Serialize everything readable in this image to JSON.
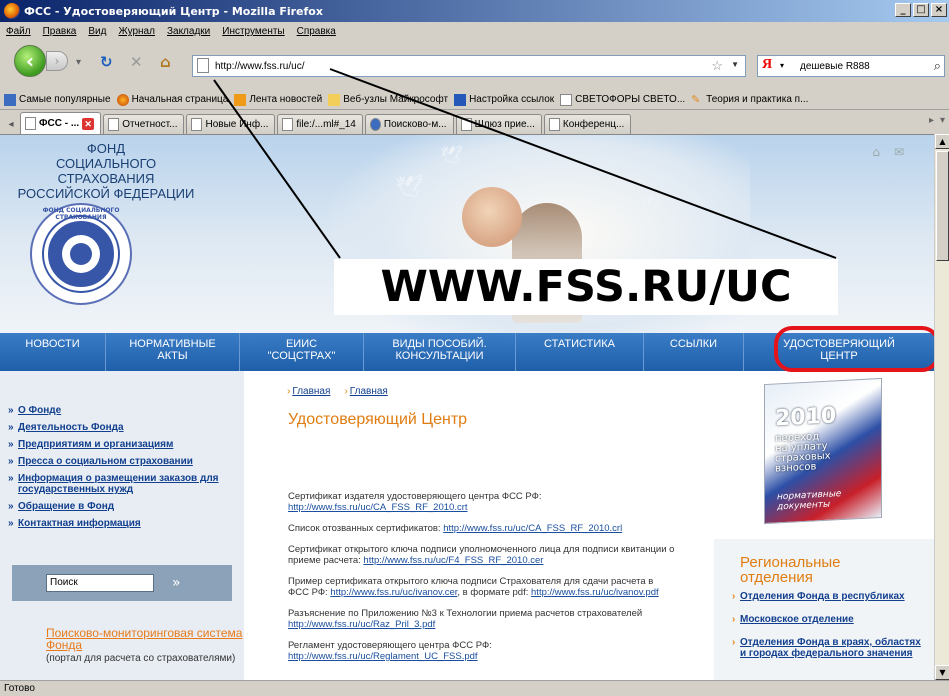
{
  "window": {
    "title": "ФСС - Удостоверяющий Центр - Mozilla Firefox",
    "minimize": "_",
    "maximize": "□",
    "close": "×"
  },
  "menu": [
    "Файл",
    "Правка",
    "Вид",
    "Журнал",
    "Закладки",
    "Инструменты",
    "Справка"
  ],
  "nav": {
    "url": "http://www.fss.ru/uc/",
    "search_value": "дешевые R888",
    "search_engine": "Я"
  },
  "bookmarks": [
    {
      "label": "Самые популярные",
      "icon": "blue-square-icon"
    },
    {
      "label": "Начальная страница",
      "icon": "firefox-icon"
    },
    {
      "label": "Лента новостей",
      "icon": "rss-icon"
    },
    {
      "label": "Веб-узлы Майкрософт",
      "icon": "folder-icon"
    },
    {
      "label": "Настройка ссылок",
      "icon": "ms-icon"
    },
    {
      "label": "СВЕТОФОРЫ СВЕТО...",
      "icon": "page-icon"
    },
    {
      "label": "Теория и практика п...",
      "icon": "pencil-icon"
    }
  ],
  "tabs": [
    {
      "label": "ФСС - ...",
      "active": true
    },
    {
      "label": "Отчетност...",
      "active": false
    },
    {
      "label": "Новые Инф...",
      "active": false
    },
    {
      "label": "file:/...ml#_14",
      "active": false
    },
    {
      "label": "Поисково-м...",
      "active": false
    },
    {
      "label": "Шлюз прие...",
      "active": false
    },
    {
      "label": "Конференц...",
      "active": false
    }
  ],
  "page": {
    "org_name": "ФОНД\nСОЦИАЛЬНОГО СТРАХОВАНИЯ\nРОССИЙСКОЙ ФЕДЕРАЦИИ",
    "emblem_text": "ФОНД СОЦИАЛЬНОГО СТРАХОВАНИЯ",
    "overlay_url": "WWW.FSS.RU/UC",
    "main_nav": [
      {
        "label": "НОВОСТИ"
      },
      {
        "label": "НОРМАТИВНЫЕ\nАКТЫ"
      },
      {
        "label": "ЕИИС\n\"СОЦСТРАХ\""
      },
      {
        "label": "ВИДЫ ПОСОБИЙ.\nКОНСУЛЬТАЦИИ"
      },
      {
        "label": "СТАТИСТИКА"
      },
      {
        "label": "ССЫЛКИ"
      },
      {
        "label": "УДОСТОВЕРЯЮЩИЙ\nЦЕНТР"
      }
    ],
    "left_menu": [
      "О Фонде",
      "Деятельность Фонда",
      "Предприятиям и организациям",
      "Пресса о социальном страховании",
      "Информация о размещении заказов для государственных нужд",
      "Обращение в Фонд",
      "Контактная информация"
    ],
    "search_placeholder": "Поиск",
    "promo_title": "Поисково-мониторинговая система Фонда",
    "promo_desc": "(портал для расчета со страхователями)",
    "breadcrumb": [
      "Главная",
      "Главная"
    ],
    "page_title": "Удостоверяющий Центр",
    "paragraphs": [
      {
        "text": "Сертификат издателя удостоверяющего центра ФСС РФ: ",
        "link": "http://www.fss.ru/uc/CA_FSS_RF_2010.crt",
        "text2": "",
        "link2": ""
      },
      {
        "text": "Список отозванных сертификатов:  ",
        "link": "http://www.fss.ru/uc/CA_FSS_RF_2010.crl",
        "text2": "",
        "link2": ""
      },
      {
        "text": "Сертификат открытого ключа подписи уполномоченного лица для подписи квитанции о приеме расчета: ",
        "link": "http://www.fss.ru/uc/F4_FSS_RF_2010.cer",
        "text2": "",
        "link2": ""
      },
      {
        "text": "Пример сертификата открытого ключа подписи Страхователя для сдачи расчета в ФСС РФ: ",
        "link": "http://www.fss.ru/uc/ivanov.cer",
        "text2": ", в формате pdf: ",
        "link2": "http://www.fss.ru/uc/ivanov.pdf"
      },
      {
        "text": "Разъяснение по Приложению №3 к Технологии приема расчетов страхователей ",
        "link": "http://www.fss.ru/uc/Raz_Pril_3.pdf",
        "text2": "",
        "link2": ""
      },
      {
        "text": "Регламент удостоверяющего центра ФСС РФ: ",
        "link": "http://www.fss.ru/uc/Reglament_UC_FSS.pdf",
        "text2": "",
        "link2": ""
      }
    ],
    "book": {
      "year": "2010",
      "title": "переход\nна уплату\nстраховых\nвзносов",
      "subtitle": "нормативные\nдокументы"
    },
    "regional_title": "Региональные\nотделения",
    "regional_items": [
      "Отделения Фонда в республиках",
      "Московское отделение",
      "Отделения Фонда в краях, областях и городах федерального значения"
    ]
  },
  "status": "Готово",
  "colors": {
    "accent_orange": "#e07d12",
    "nav_blue": "#1f5fa9",
    "link_blue": "#123f8e",
    "highlight_red": "#e5141a"
  }
}
